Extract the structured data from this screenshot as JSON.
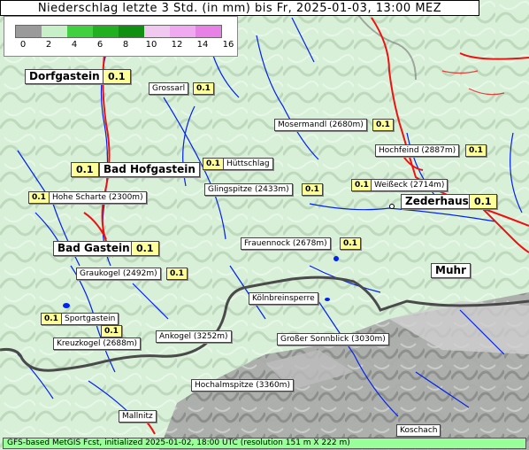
{
  "title": "Niederschlag letzte 3 Std. (in mm) bis Fr, 2025-01-03, 13:00 MEZ",
  "legend": {
    "ticks": [
      "0",
      "2",
      "4",
      "6",
      "8",
      "10",
      "12",
      "14",
      "16"
    ],
    "colors": [
      "#9a9a9a",
      "#c8f0c8",
      "#40d040",
      "#20b020",
      "#109010",
      "#f0c8f0",
      "#f0a8f0",
      "#e880e8",
      "#e040e0"
    ]
  },
  "places": [
    {
      "name": "Dorfgastein",
      "value": "0.1"
    },
    {
      "name": "Grossarl",
      "value": "0.1"
    },
    {
      "name": "Mosermandl (2680m)",
      "value": "0.1"
    },
    {
      "name": "Hochfeind (2887m)",
      "value": "0.1"
    },
    {
      "name": "Bad Hofgastein",
      "value": "0.1"
    },
    {
      "name": "Hüttschlag",
      "value": "0.1"
    },
    {
      "name": "Hohe Scharte (2300m)",
      "value": "0.1"
    },
    {
      "name": "Glingspitze (2433m)",
      "value": "0.1"
    },
    {
      "name": "Weißeck (2714m)",
      "value": "0.1"
    },
    {
      "name": "Zederhaus",
      "value": "0.1"
    },
    {
      "name": "Bad Gastein",
      "value": "0.1"
    },
    {
      "name": "Frauennock (2678m)",
      "value": "0.1"
    },
    {
      "name": "Graukogel (2492m)",
      "value": "0.1"
    },
    {
      "name": "Muhr",
      "value": ""
    },
    {
      "name": "Kölnbreinsperre",
      "value": ""
    },
    {
      "name": "Sportgastein",
      "value": "0.1"
    },
    {
      "name": "Kreuzkogel (2688m)",
      "value": "0.1"
    },
    {
      "name": "Ankogel (3252m)",
      "value": ""
    },
    {
      "name": "Großer Sonnblick (3030m)",
      "value": ""
    },
    {
      "name": "Hochalmspitze (3360m)",
      "value": ""
    },
    {
      "name": "Mallnitz",
      "value": ""
    },
    {
      "name": "Koschach",
      "value": ""
    }
  ],
  "footer": "GFS-based MetGIS Fcst, initialized 2025-01-02, 18:00 UTC  (resolution 151 m X 222 m)"
}
